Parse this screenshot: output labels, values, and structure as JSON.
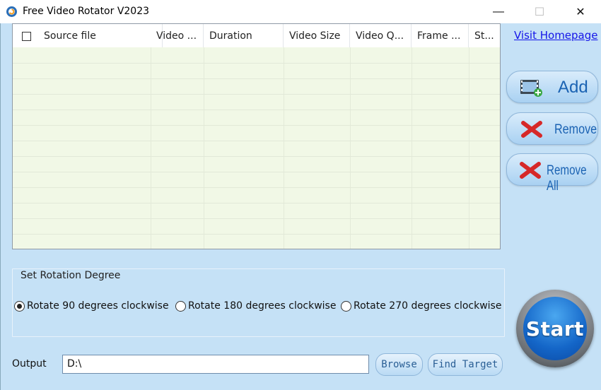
{
  "window": {
    "title": "Free Video Rotator V2023",
    "minimize_glyph": "—",
    "maximize_glyph": "☐",
    "close_glyph": "✕"
  },
  "table": {
    "columns": [
      "Source file",
      "Video ...",
      "Duration",
      "Video Size",
      "Video Q...",
      "Frame ...",
      "St..."
    ],
    "rows": []
  },
  "sidebar": {
    "homepage_link": "Visit Homepage",
    "add_label": "Add",
    "remove_label": "Remove",
    "remove_all_label": "Remove All"
  },
  "rotation": {
    "group_title": "Set Rotation Degree",
    "options": [
      {
        "label": "Rotate 90 degrees clockwise",
        "checked": true
      },
      {
        "label": "Rotate 180 degrees clockwise",
        "checked": false
      },
      {
        "label": "Rotate 270 degrees clockwise",
        "checked": false
      }
    ]
  },
  "start_label": "Start",
  "output": {
    "label": "Output",
    "value": "D:\\",
    "browse_label": "Browse",
    "find_target_label": "Find Target"
  },
  "colors": {
    "background": "#c5e1f6",
    "table_bg": "#f1f8e6",
    "link": "#1515e8",
    "button_text": "#1b63b3",
    "start_blue": "#1466c8"
  }
}
